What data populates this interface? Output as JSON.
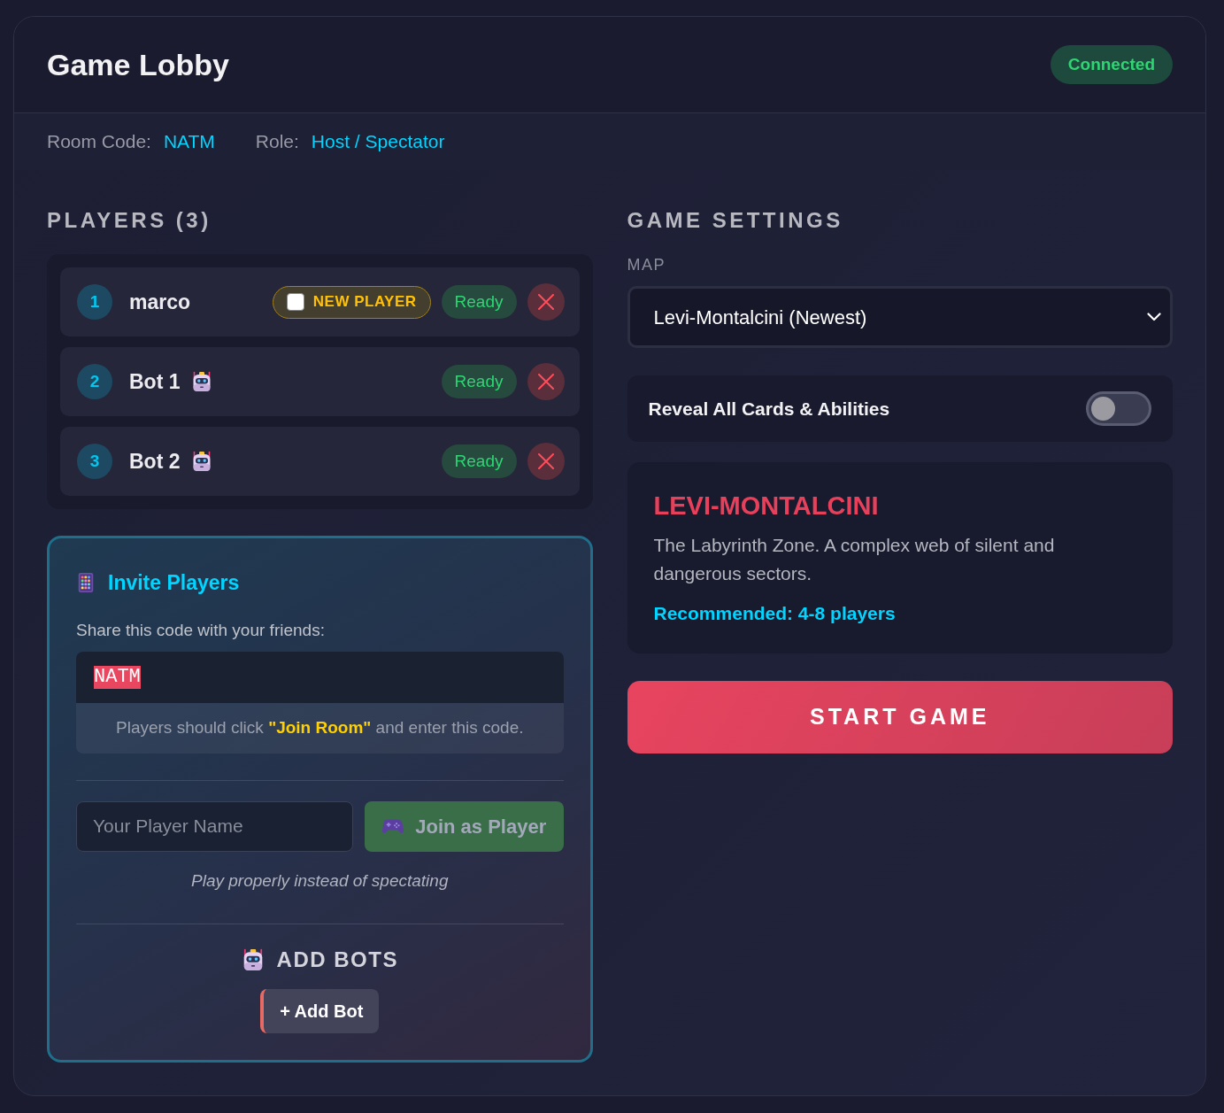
{
  "header": {
    "title": "Game Lobby",
    "status": "Connected"
  },
  "info_bar": [
    {
      "label": "Room Code:",
      "value": "NATM"
    },
    {
      "label": "Role:",
      "value": "Host / Spectator"
    }
  ],
  "players": {
    "heading": "PLAYERS (3)",
    "items": [
      {
        "number": "1",
        "name": "marco",
        "kind": "human",
        "new_player": {
          "label": "NEW PLAYER",
          "checked": false
        },
        "status": "Ready"
      },
      {
        "number": "2",
        "name": "Bot 1",
        "kind": "bot",
        "status": "Ready"
      },
      {
        "number": "3",
        "name": "Bot 2",
        "kind": "bot",
        "status": "Ready"
      }
    ]
  },
  "invite": {
    "title": "Invite Players",
    "prompt": "Share this code with your friends:",
    "code": {
      "value": "NATM",
      "selected": true
    },
    "hint": "Players should click **\"Join Room\"** and enter this code.",
    "name_field": {
      "placeholder": "Your Player Name"
    },
    "join_button": {
      "label": "Join as Player",
      "disabled": true
    },
    "join_note": "Play properly instead of spectating",
    "bots": {
      "heading": "ADD BOTS",
      "button": "+ Add Bot"
    }
  },
  "settings": {
    "heading": "GAME SETTINGS",
    "map": {
      "label": "MAP",
      "value": "Levi-Montalcini (Newest)"
    },
    "toggles": [
      {
        "label": "Reveal All Cards & Abilities",
        "on": false
      }
    ],
    "map_info": {
      "title": "LEVI-MONTALCINI",
      "description": "The Labyrinth Zone. A complex web of silent and dangerous sectors.",
      "recommended": "Recommended: 4-8 players"
    },
    "start_button": "START GAME"
  }
}
